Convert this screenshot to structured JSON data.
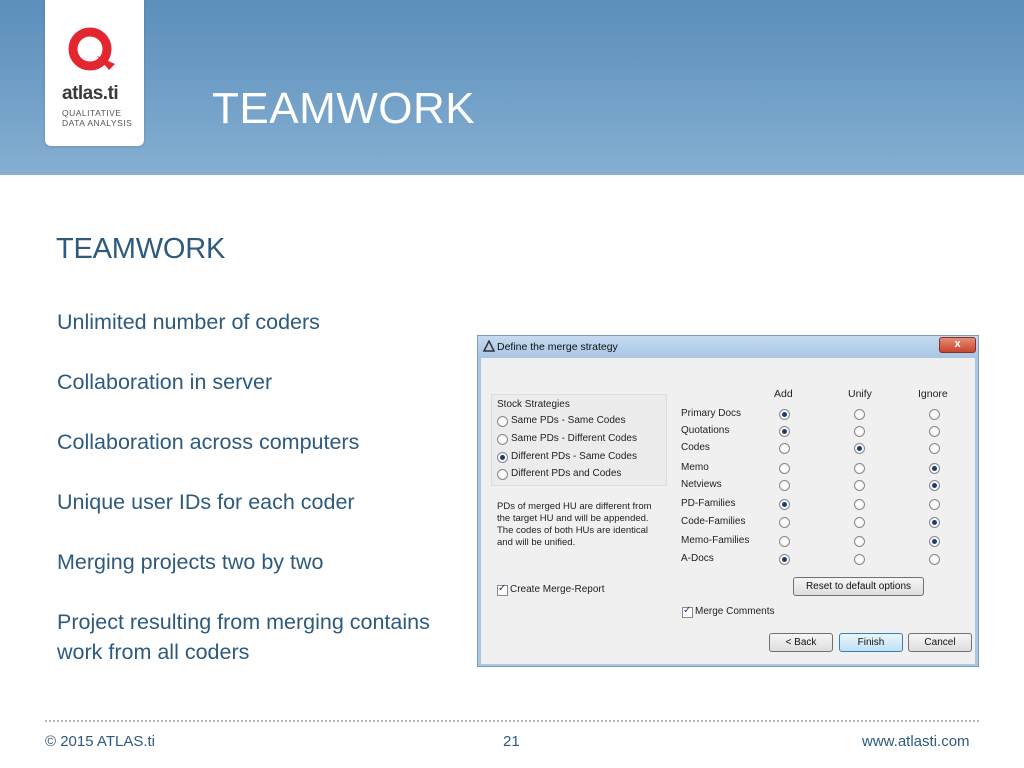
{
  "logo": {
    "wordmark": "atlas.ti",
    "tagline_line1": "QUALITATIVE",
    "tagline_line2": "DATA ANALYSIS",
    "brand_color": "#e32630"
  },
  "header": {
    "title": "TEAMWORK"
  },
  "content": {
    "title": "TEAMWORK",
    "bullets": [
      "Unlimited number of coders",
      "Collaboration in server",
      "Collaboration across computers",
      "Unique user IDs for each coder",
      "Merging projects two by two",
      "Project resulting from merging contains work from all coders"
    ]
  },
  "dialog": {
    "title": "Define the merge strategy",
    "close_label": "x",
    "stock": {
      "title": "Stock Strategies",
      "options": [
        {
          "label": "Same PDs - Same Codes",
          "selected": false
        },
        {
          "label": "Same PDs - Different Codes",
          "selected": false
        },
        {
          "label": "Different PDs - Same Codes",
          "selected": true
        },
        {
          "label": "Different PDs and Codes",
          "selected": false
        }
      ]
    },
    "description": "PDs of merged HU are different from the target HU and will be appended. The codes of both HUs are identical and will be unified.",
    "create_report": {
      "label": "Create Merge-Report",
      "checked": true
    },
    "columns": [
      "Add",
      "Unify",
      "Ignore"
    ],
    "rows": [
      {
        "label": "Primary Docs",
        "choice": "Add"
      },
      {
        "label": "Quotations",
        "choice": "Add"
      },
      {
        "label": "Codes",
        "choice": "Unify"
      },
      {
        "label": "Memo",
        "choice": "Ignore"
      },
      {
        "label": "Netviews",
        "choice": "Ignore"
      },
      {
        "label": "PD-Families",
        "choice": "Add"
      },
      {
        "label": "Code-Families",
        "choice": "Ignore"
      },
      {
        "label": "Memo-Families",
        "choice": "Ignore"
      },
      {
        "label": "A-Docs",
        "choice": "Add"
      }
    ],
    "reset_label": "Reset to default options",
    "merge_comments": {
      "label": "Merge Comments",
      "checked": true
    },
    "buttons": {
      "back": "< Back",
      "finish": "Finish",
      "cancel": "Cancel"
    }
  },
  "footer": {
    "copyright": "© 2015 ATLAS.ti",
    "page_number": "21",
    "url": "www.atlasti.com"
  }
}
